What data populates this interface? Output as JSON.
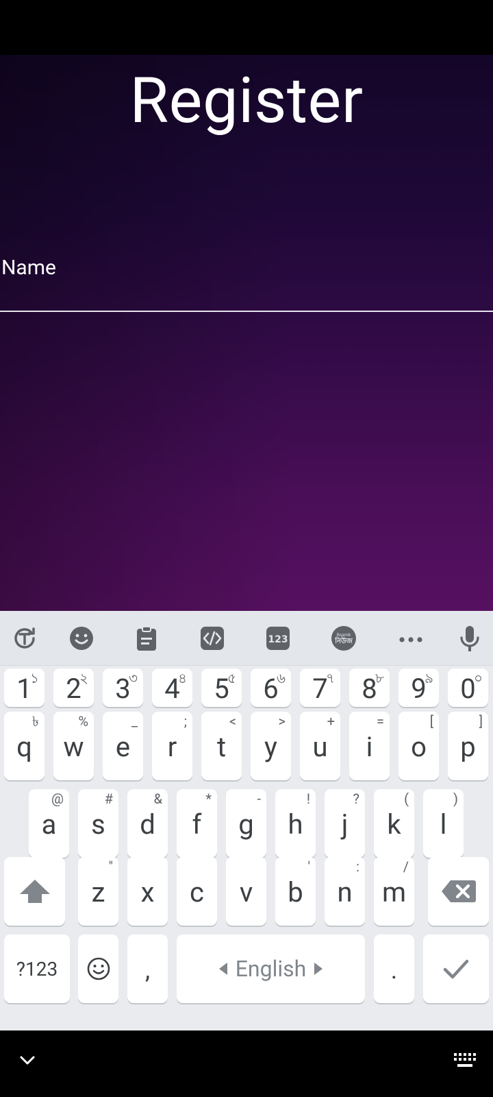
{
  "page": {
    "title": "Register"
  },
  "form": {
    "name_label": "Name",
    "name_value": ""
  },
  "keyboard": {
    "toolbar": [
      "text-select-icon",
      "emoji-sticker-icon",
      "clipboard-icon",
      "code-icon",
      "numpad-icon",
      "news-app-icon",
      "more-icon",
      "mic-icon"
    ],
    "toolbar_labels": {
      "numpad": "123",
      "news_top": "Roamk",
      "news_bottom": "নিউজ"
    },
    "number_row": [
      {
        "k": "1",
        "h": "১"
      },
      {
        "k": "2",
        "h": "২"
      },
      {
        "k": "3",
        "h": "৩"
      },
      {
        "k": "4",
        "h": "৪"
      },
      {
        "k": "5",
        "h": "৫"
      },
      {
        "k": "6",
        "h": "৬"
      },
      {
        "k": "7",
        "h": "৭"
      },
      {
        "k": "8",
        "h": "৮"
      },
      {
        "k": "9",
        "h": "৯"
      },
      {
        "k": "0",
        "h": "০"
      }
    ],
    "row1": [
      {
        "k": "q",
        "h": "৳"
      },
      {
        "k": "w",
        "h": "%"
      },
      {
        "k": "e",
        "h": "_"
      },
      {
        "k": "r",
        "h": ";"
      },
      {
        "k": "t",
        "h": "<"
      },
      {
        "k": "y",
        "h": ">"
      },
      {
        "k": "u",
        "h": "+"
      },
      {
        "k": "i",
        "h": "="
      },
      {
        "k": "o",
        "h": "["
      },
      {
        "k": "p",
        "h": "]"
      }
    ],
    "row2": [
      {
        "k": "a",
        "h": "@"
      },
      {
        "k": "s",
        "h": "#"
      },
      {
        "k": "d",
        "h": "&"
      },
      {
        "k": "f",
        "h": "*"
      },
      {
        "k": "g",
        "h": "-"
      },
      {
        "k": "h",
        "h": "!"
      },
      {
        "k": "j",
        "h": "?"
      },
      {
        "k": "k",
        "h": "("
      },
      {
        "k": "l",
        "h": ")"
      }
    ],
    "row3": [
      {
        "k": "z",
        "h": "\""
      },
      {
        "k": "x",
        "h": ""
      },
      {
        "k": "c",
        "h": ""
      },
      {
        "k": "v",
        "h": ""
      },
      {
        "k": "b",
        "h": "'"
      },
      {
        "k": "n",
        "h": ":"
      },
      {
        "k": "m",
        "h": "/"
      }
    ],
    "bottom": {
      "symbols": "?123",
      "comma": ",",
      "space": "English",
      "period": "."
    }
  },
  "colors": {
    "accent": "#3c4043",
    "bg_top": "#140628",
    "bg_bottom": "#561060"
  }
}
